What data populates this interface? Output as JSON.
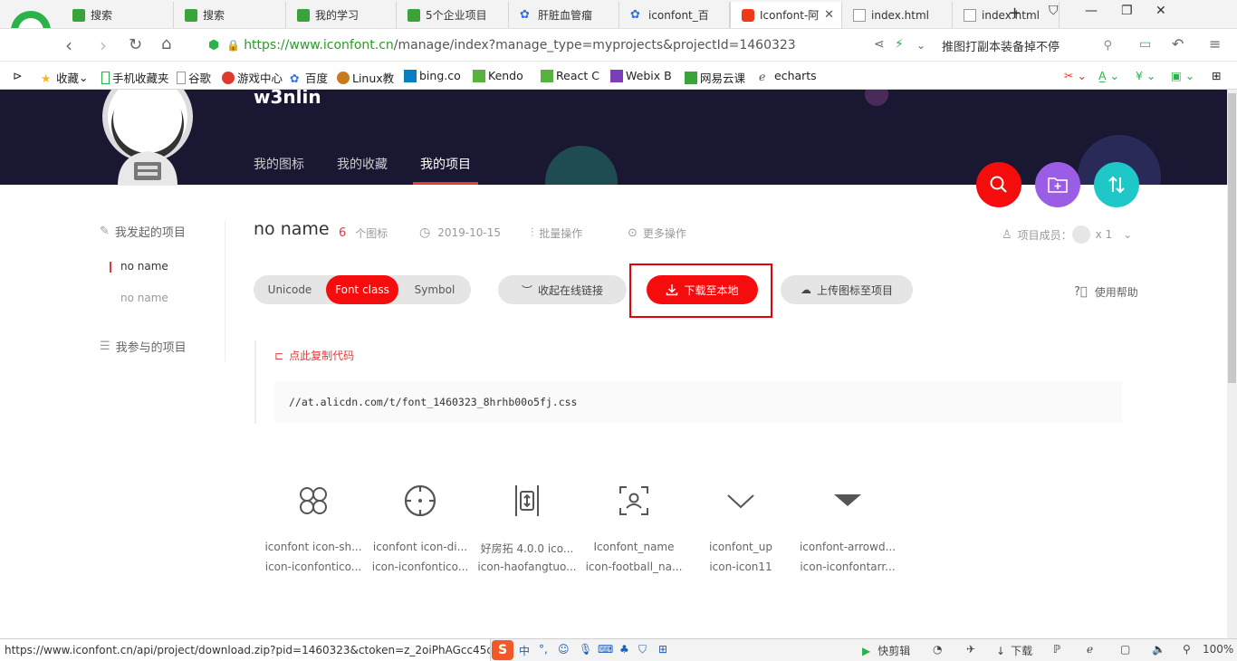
{
  "browser": {
    "tabs": [
      {
        "label": "搜索",
        "icon": "green-doc-icon"
      },
      {
        "label": "搜索",
        "icon": "green-doc-icon"
      },
      {
        "label": "我的学习",
        "icon": "green-doc-icon"
      },
      {
        "label": "5个企业项目",
        "icon": "green-doc-icon"
      },
      {
        "label": "肝脏血管瘤",
        "icon": "baidu-paw-icon"
      },
      {
        "label": "iconfont_百",
        "icon": "baidu-paw-icon"
      },
      {
        "label": "Iconfont-阿",
        "icon": "iconfont-icon",
        "active": true
      },
      {
        "label": "index.html",
        "icon": "file-icon"
      },
      {
        "label": "index.html",
        "icon": "file-icon"
      }
    ],
    "url_secure": "https://www.iconfont.cn",
    "url_rest": "/manage/index?manage_type=myprojects&projectId=1460323",
    "search_text": "推图打副本装备掉不停",
    "bookmarks": [
      "收藏",
      "手机收藏夹",
      "谷歌",
      "游戏中心",
      "百度",
      "Linux教",
      "bing.co",
      "Kendo",
      "React C",
      "Webix B",
      "网易云课",
      "echarts"
    ]
  },
  "header": {
    "username": "w3nlin",
    "nav": [
      "我的图标",
      "我的收藏",
      "我的项目"
    ],
    "active_nav": "我的项目"
  },
  "sidebar": {
    "my_projects_title": "我发起的项目",
    "my_projects": [
      "no name",
      "no name"
    ],
    "joined_projects_title": "我参与的项目"
  },
  "project": {
    "name": "no name",
    "icon_count": "6",
    "icon_count_label": "个图标",
    "date": "2019-10-15",
    "batch_label": "批量操作",
    "more_label": "更多操作",
    "members_label": "项目成员：",
    "members_count": "x 1",
    "help_label": "使用帮助"
  },
  "modes": [
    "Unicode",
    "Font class",
    "Symbol"
  ],
  "active_mode": "Font class",
  "actions": {
    "collapse_link": "收起在线链接",
    "download": "下载至本地",
    "upload": "上传图标至项目"
  },
  "code": {
    "copy_label": "点此复制代码",
    "css_url": "//at.alicdn.com/t/font_1460323_8hrhb00o5fj.css"
  },
  "icons": [
    {
      "name": "iconfont icon-sh...",
      "class": "icon-iconfontico...",
      "glyph": "clover-icon"
    },
    {
      "name": "iconfont icon-di...",
      "class": "icon-iconfontico...",
      "glyph": "crosshair-icon"
    },
    {
      "name": "好房拓 4.0.0 ico...",
      "class": "icon-haofangtuo...",
      "glyph": "slider-icon"
    },
    {
      "name": "Iconfont_name",
      "class": "icon-football_na...",
      "glyph": "id-scan-icon"
    },
    {
      "name": "iconfont_up",
      "class": "icon-icon11",
      "glyph": "chevron-down-icon"
    },
    {
      "name": "iconfont-arrowd...",
      "class": "icon-iconfontarr...",
      "glyph": "triangle-down-icon"
    }
  ],
  "status": {
    "url": "https://www.iconfont.cn/api/project/download.zip?pid=1460323&ctoken=z_2oiPhAGcc45qZF",
    "clip": "快剪辑",
    "download": "下载",
    "zoom": "100%"
  },
  "colors": {
    "accent": "#f50c0c",
    "hero": "#1a1733",
    "fab_search": "#f50c0c",
    "fab_folder": "#9b5de5",
    "fab_sort": "#1ec8c8"
  }
}
